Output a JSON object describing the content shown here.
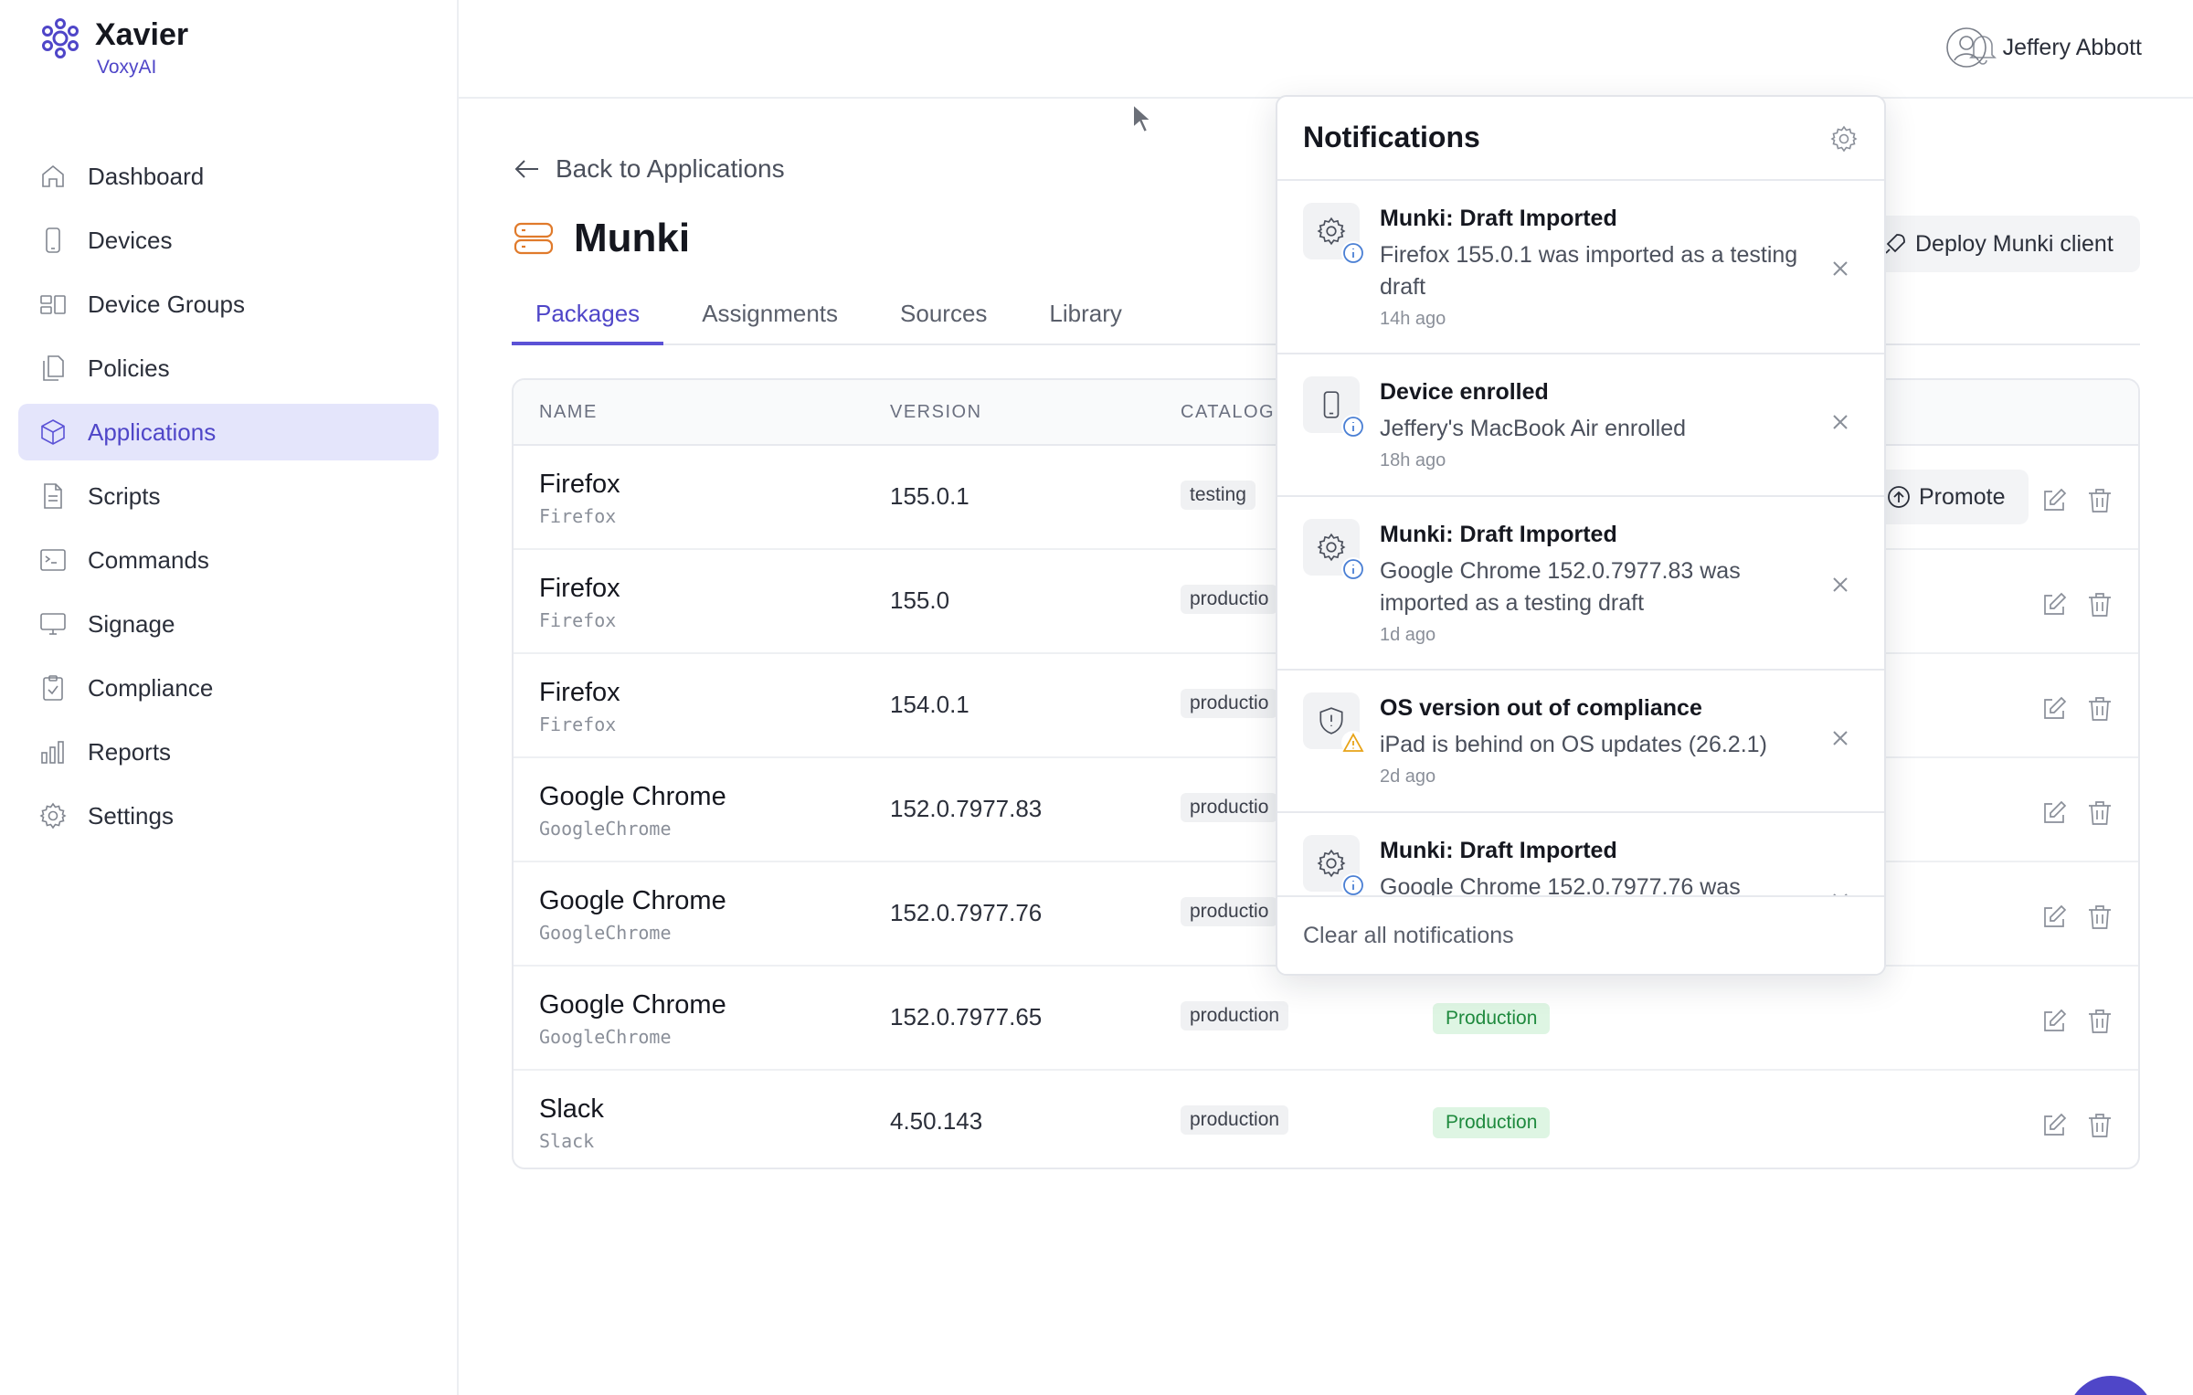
{
  "brand": {
    "name": "Xavier",
    "org": "VoxyAI"
  },
  "sidebar": {
    "items": [
      {
        "label": "Dashboard",
        "icon": "home-icon"
      },
      {
        "label": "Devices",
        "icon": "phone-icon"
      },
      {
        "label": "Device Groups",
        "icon": "device-groups-icon"
      },
      {
        "label": "Policies",
        "icon": "documents-icon"
      },
      {
        "label": "Applications",
        "icon": "cube-icon",
        "active": true
      },
      {
        "label": "Scripts",
        "icon": "file-code-icon"
      },
      {
        "label": "Commands",
        "icon": "terminal-icon"
      },
      {
        "label": "Signage",
        "icon": "monitor-icon"
      },
      {
        "label": "Compliance",
        "icon": "clipboard-check-icon"
      },
      {
        "label": "Reports",
        "icon": "bar-chart-icon"
      },
      {
        "label": "Settings",
        "icon": "gear-icon"
      }
    ]
  },
  "header": {
    "user_name": "Jeffery Abbott"
  },
  "main": {
    "back_label": "Back to Applications",
    "title": "Munki",
    "deploy_label": "Deploy Munki client",
    "tabs": [
      {
        "label": "Packages",
        "active": true
      },
      {
        "label": "Assignments"
      },
      {
        "label": "Sources"
      },
      {
        "label": "Library"
      }
    ],
    "table": {
      "columns": [
        "NAME",
        "VERSION",
        "CATALOG"
      ],
      "rows": [
        {
          "name": "Firefox",
          "id": "Firefox",
          "version": "155.0.1",
          "catalog": "testing",
          "status": "",
          "action": "Promote"
        },
        {
          "name": "Firefox",
          "id": "Firefox",
          "version": "155.0",
          "catalog": "productio",
          "status": ""
        },
        {
          "name": "Firefox",
          "id": "Firefox",
          "version": "154.0.1",
          "catalog": "productio",
          "status": ""
        },
        {
          "name": "Google Chrome",
          "id": "GoogleChrome",
          "version": "152.0.7977.83",
          "catalog": "productio",
          "status": ""
        },
        {
          "name": "Google Chrome",
          "id": "GoogleChrome",
          "version": "152.0.7977.76",
          "catalog": "productio",
          "status": ""
        },
        {
          "name": "Google Chrome",
          "id": "GoogleChrome",
          "version": "152.0.7977.65",
          "catalog": "production",
          "status": "Production"
        },
        {
          "name": "Slack",
          "id": "Slack",
          "version": "4.50.143",
          "catalog": "production",
          "status": "Production"
        }
      ]
    }
  },
  "notifications": {
    "title": "Notifications",
    "clear_label": "Clear all notifications",
    "items": [
      {
        "title": "Munki: Draft Imported",
        "body": "Firefox 155.0.1 was imported as a testing draft",
        "time": "14h ago",
        "icon": "gear-icon",
        "badge": "info"
      },
      {
        "title": "Device enrolled",
        "body": "Jeffery's MacBook Air enrolled",
        "time": "18h ago",
        "icon": "phone-icon",
        "badge": "info"
      },
      {
        "title": "Munki: Draft Imported",
        "body": "Google Chrome 152.0.7977.83 was imported as a testing draft",
        "time": "1d ago",
        "icon": "gear-icon",
        "badge": "info"
      },
      {
        "title": "OS version out of compliance",
        "body": "iPad is behind on OS updates (26.2.1)",
        "time": "2d ago",
        "icon": "shield-icon",
        "badge": "warning"
      },
      {
        "title": "Munki: Draft Imported",
        "body": "Google Chrome 152.0.7977.76 was",
        "time": "",
        "icon": "gear-icon",
        "badge": "info"
      }
    ]
  },
  "colors": {
    "accent": "#4f46c8",
    "accent_bg": "#e4e5fb",
    "success": "#1f8a3e",
    "warning": "#e8a317",
    "info": "#4a7fd4",
    "brand_icon": "#e07a2b"
  }
}
